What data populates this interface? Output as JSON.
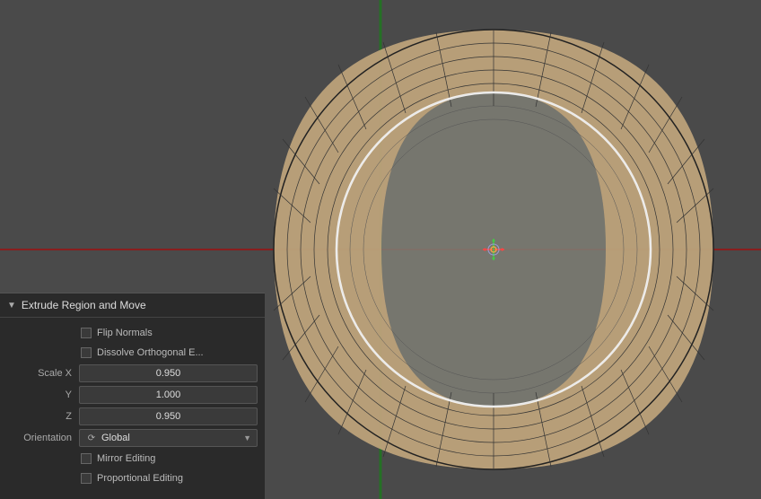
{
  "viewport": {
    "background": "#4a4a4a"
  },
  "panel": {
    "title": "Extrude Region and Move",
    "flip_normals_label": "Flip Normals",
    "dissolve_orthogonal_label": "Dissolve Orthogonal E...",
    "scale_x_label": "Scale X",
    "scale_y_label": "Y",
    "scale_z_label": "Z",
    "scale_x_value": "0.950",
    "scale_y_value": "1.000",
    "scale_z_value": "0.950",
    "orientation_label": "Orientation",
    "orientation_value": "Global",
    "orientation_icon": "⟳",
    "mirror_editing_label": "Mirror Editing",
    "proportional_editing_label": "Proportional Editing"
  }
}
